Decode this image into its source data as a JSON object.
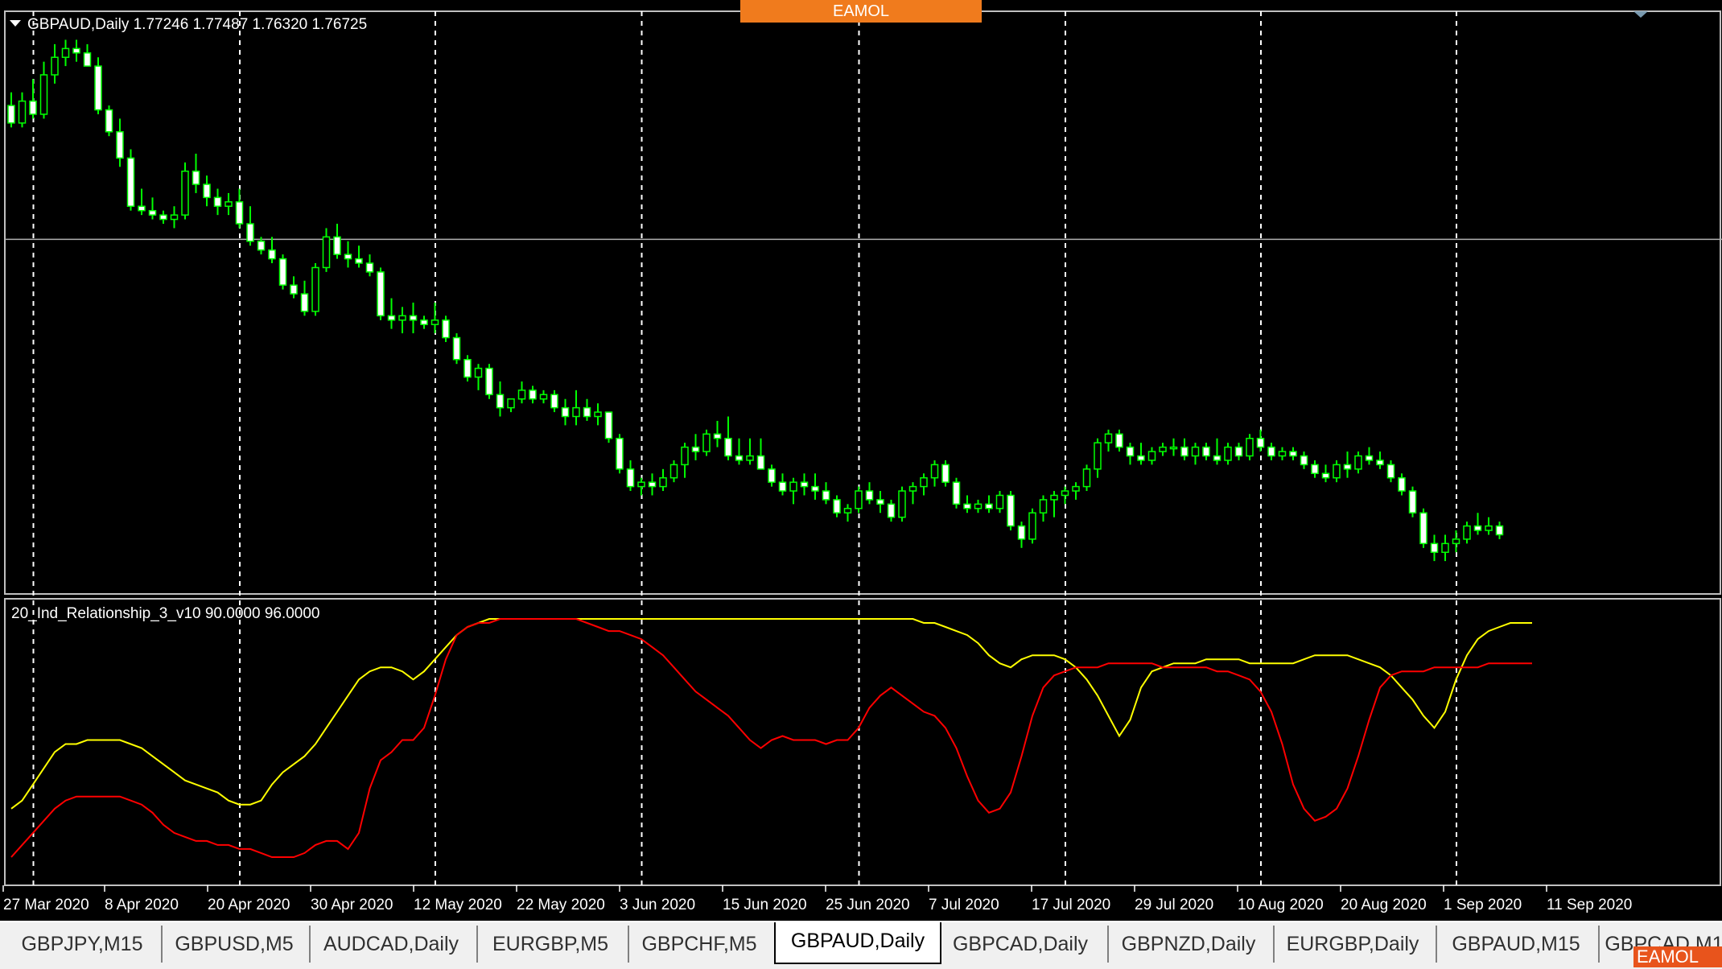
{
  "colors": {
    "candle_up_fill": "#000000",
    "candle_down_fill": "#ffffff",
    "candle_outline": "#00ff00",
    "grid": "#ffffff",
    "indicator_line_1": "#ffff00",
    "indicator_line_2": "#ff0000",
    "background": "#000000"
  },
  "logo": {
    "text": "EAMOL"
  },
  "main_chart": {
    "header": "GBPAUD,Daily  1.77246 1.77487 1.76320 1.76725",
    "price_line": 1.76725
  },
  "indicator": {
    "header": "20_Ind_Relationship_3_v10 90.0000 96.0000",
    "levels": [
      90,
      96
    ]
  },
  "x_axis_labels": [
    "27 Mar 2020",
    "8 Apr 2020",
    "20 Apr 2020",
    "30 Apr 2020",
    "12 May 2020",
    "22 May 2020",
    "3 Jun 2020",
    "15 Jun 2020",
    "25 Jun 2020",
    "7 Jul 2020",
    "17 Jul 2020",
    "29 Jul 2020",
    "10 Aug 2020",
    "20 Aug 2020",
    "1 Sep 2020",
    "11 Sep 2020"
  ],
  "tabs": [
    {
      "label": "GBPJPY,M15",
      "active": false
    },
    {
      "label": "GBPUSD,M5",
      "active": false
    },
    {
      "label": "AUDCAD,Daily",
      "active": false
    },
    {
      "label": "EURGBP,M5",
      "active": false
    },
    {
      "label": "GBPCHF,M5",
      "active": false
    },
    {
      "label": "GBPAUD,Daily",
      "active": true
    },
    {
      "label": "GBPCAD,Daily",
      "active": false
    },
    {
      "label": "GBPNZD,Daily",
      "active": false
    },
    {
      "label": "EURGBP,Daily",
      "active": false
    },
    {
      "label": "GBPAUD,M15",
      "active": false
    },
    {
      "label": "GBPCAD,M1",
      "active": false
    }
  ],
  "chart_data": {
    "type": "candlestick",
    "symbol": "GBPAUD",
    "timeframe": "Daily",
    "ohlc": [
      [
        1.92,
        1.935,
        1.895,
        1.9
      ],
      [
        1.9,
        1.935,
        1.895,
        1.925
      ],
      [
        1.925,
        1.95,
        1.905,
        1.91
      ],
      [
        1.91,
        1.97,
        1.905,
        1.955
      ],
      [
        1.955,
        1.99,
        1.945,
        1.975
      ],
      [
        1.975,
        1.995,
        1.965,
        1.985
      ],
      [
        1.985,
        1.995,
        1.97,
        1.98
      ],
      [
        1.98,
        1.99,
        1.97,
        1.965
      ],
      [
        1.965,
        1.975,
        1.91,
        1.915
      ],
      [
        1.915,
        1.92,
        1.885,
        1.89
      ],
      [
        1.89,
        1.905,
        1.85,
        1.86
      ],
      [
        1.86,
        1.87,
        1.8,
        1.805
      ],
      [
        1.805,
        1.825,
        1.795,
        1.8
      ],
      [
        1.8,
        1.815,
        1.79,
        1.795
      ],
      [
        1.795,
        1.8,
        1.785,
        1.79
      ],
      [
        1.79,
        1.805,
        1.78,
        1.795
      ],
      [
        1.795,
        1.855,
        1.79,
        1.845
      ],
      [
        1.845,
        1.865,
        1.82,
        1.83
      ],
      [
        1.83,
        1.84,
        1.805,
        1.815
      ],
      [
        1.815,
        1.825,
        1.795,
        1.805
      ],
      [
        1.805,
        1.82,
        1.795,
        1.81
      ],
      [
        1.81,
        1.825,
        1.78,
        1.785
      ],
      [
        1.785,
        1.805,
        1.76,
        1.765
      ],
      [
        1.765,
        1.77,
        1.75,
        1.755
      ],
      [
        1.755,
        1.77,
        1.74,
        1.745
      ],
      [
        1.745,
        1.75,
        1.71,
        1.715
      ],
      [
        1.715,
        1.725,
        1.7,
        1.705
      ],
      [
        1.705,
        1.72,
        1.68,
        1.685
      ],
      [
        1.685,
        1.74,
        1.68,
        1.735
      ],
      [
        1.735,
        1.78,
        1.73,
        1.77
      ],
      [
        1.77,
        1.785,
        1.745,
        1.75
      ],
      [
        1.75,
        1.765,
        1.735,
        1.745
      ],
      [
        1.745,
        1.76,
        1.735,
        1.74
      ],
      [
        1.74,
        1.75,
        1.725,
        1.73
      ],
      [
        1.73,
        1.735,
        1.675,
        1.68
      ],
      [
        1.68,
        1.7,
        1.665,
        1.675
      ],
      [
        1.675,
        1.69,
        1.66,
        1.68
      ],
      [
        1.68,
        1.695,
        1.66,
        1.675
      ],
      [
        1.675,
        1.68,
        1.665,
        1.67
      ],
      [
        1.67,
        1.695,
        1.66,
        1.675
      ],
      [
        1.675,
        1.68,
        1.65,
        1.655
      ],
      [
        1.655,
        1.66,
        1.625,
        1.63
      ],
      [
        1.63,
        1.635,
        1.605,
        1.61
      ],
      [
        1.61,
        1.625,
        1.595,
        1.62
      ],
      [
        1.62,
        1.625,
        1.585,
        1.59
      ],
      [
        1.59,
        1.605,
        1.565,
        1.575
      ],
      [
        1.575,
        1.585,
        1.57,
        1.585
      ],
      [
        1.585,
        1.605,
        1.58,
        1.595
      ],
      [
        1.595,
        1.6,
        1.58,
        1.585
      ],
      [
        1.585,
        1.595,
        1.58,
        1.59
      ],
      [
        1.59,
        1.595,
        1.57,
        1.575
      ],
      [
        1.575,
        1.585,
        1.555,
        1.565
      ],
      [
        1.565,
        1.595,
        1.555,
        1.575
      ],
      [
        1.575,
        1.585,
        1.56,
        1.565
      ],
      [
        1.565,
        1.58,
        1.555,
        1.57
      ],
      [
        1.57,
        1.57,
        1.535,
        1.54
      ],
      [
        1.54,
        1.545,
        1.5,
        1.505
      ],
      [
        1.505,
        1.515,
        1.48,
        1.485
      ],
      [
        1.485,
        1.495,
        1.475,
        1.49
      ],
      [
        1.49,
        1.5,
        1.475,
        1.485
      ],
      [
        1.485,
        1.505,
        1.48,
        1.495
      ],
      [
        1.495,
        1.515,
        1.49,
        1.51
      ],
      [
        1.51,
        1.535,
        1.495,
        1.53
      ],
      [
        1.53,
        1.545,
        1.515,
        1.525
      ],
      [
        1.525,
        1.55,
        1.52,
        1.545
      ],
      [
        1.545,
        1.56,
        1.53,
        1.54
      ],
      [
        1.54,
        1.565,
        1.515,
        1.52
      ],
      [
        1.52,
        1.54,
        1.51,
        1.515
      ],
      [
        1.515,
        1.54,
        1.51,
        1.52
      ],
      [
        1.52,
        1.54,
        1.505,
        1.505
      ],
      [
        1.505,
        1.51,
        1.485,
        1.49
      ],
      [
        1.49,
        1.5,
        1.475,
        1.48
      ],
      [
        1.48,
        1.495,
        1.465,
        1.49
      ],
      [
        1.49,
        1.5,
        1.475,
        1.485
      ],
      [
        1.485,
        1.5,
        1.47,
        1.48
      ],
      [
        1.48,
        1.49,
        1.465,
        1.47
      ],
      [
        1.47,
        1.475,
        1.45,
        1.455
      ],
      [
        1.455,
        1.465,
        1.445,
        1.46
      ],
      [
        1.46,
        1.485,
        1.455,
        1.48
      ],
      [
        1.48,
        1.49,
        1.465,
        1.47
      ],
      [
        1.47,
        1.48,
        1.455,
        1.465
      ],
      [
        1.465,
        1.47,
        1.445,
        1.45
      ],
      [
        1.45,
        1.485,
        1.445,
        1.48
      ],
      [
        1.48,
        1.49,
        1.465,
        1.485
      ],
      [
        1.485,
        1.5,
        1.475,
        1.495
      ],
      [
        1.495,
        1.515,
        1.485,
        1.51
      ],
      [
        1.51,
        1.515,
        1.485,
        1.49
      ],
      [
        1.49,
        1.495,
        1.46,
        1.465
      ],
      [
        1.465,
        1.475,
        1.455,
        1.46
      ],
      [
        1.46,
        1.47,
        1.455,
        1.465
      ],
      [
        1.465,
        1.475,
        1.455,
        1.46
      ],
      [
        1.46,
        1.48,
        1.455,
        1.475
      ],
      [
        1.475,
        1.48,
        1.435,
        1.44
      ],
      [
        1.44,
        1.445,
        1.415,
        1.425
      ],
      [
        1.425,
        1.46,
        1.42,
        1.455
      ],
      [
        1.455,
        1.475,
        1.445,
        1.47
      ],
      [
        1.47,
        1.48,
        1.45,
        1.475
      ],
      [
        1.475,
        1.485,
        1.465,
        1.48
      ],
      [
        1.48,
        1.49,
        1.47,
        1.485
      ],
      [
        1.485,
        1.51,
        1.48,
        1.505
      ],
      [
        1.505,
        1.54,
        1.495,
        1.535
      ],
      [
        1.535,
        1.55,
        1.525,
        1.545
      ],
      [
        1.545,
        1.55,
        1.525,
        1.53
      ],
      [
        1.53,
        1.535,
        1.51,
        1.52
      ],
      [
        1.52,
        1.535,
        1.51,
        1.515
      ],
      [
        1.515,
        1.53,
        1.51,
        1.525
      ],
      [
        1.525,
        1.535,
        1.52,
        1.53
      ],
      [
        1.53,
        1.54,
        1.52,
        1.53
      ],
      [
        1.53,
        1.54,
        1.515,
        1.52
      ],
      [
        1.52,
        1.535,
        1.51,
        1.53
      ],
      [
        1.53,
        1.535,
        1.515,
        1.52
      ],
      [
        1.52,
        1.54,
        1.51,
        1.515
      ],
      [
        1.515,
        1.535,
        1.51,
        1.53
      ],
      [
        1.53,
        1.535,
        1.515,
        1.52
      ],
      [
        1.52,
        1.545,
        1.515,
        1.54
      ],
      [
        1.54,
        1.55,
        1.525,
        1.53
      ],
      [
        1.53,
        1.535,
        1.515,
        1.52
      ],
      [
        1.52,
        1.53,
        1.515,
        1.525
      ],
      [
        1.525,
        1.53,
        1.515,
        1.52
      ],
      [
        1.52,
        1.525,
        1.505,
        1.51
      ],
      [
        1.51,
        1.515,
        1.495,
        1.5
      ],
      [
        1.5,
        1.51,
        1.49,
        1.495
      ],
      [
        1.495,
        1.515,
        1.49,
        1.51
      ],
      [
        1.51,
        1.525,
        1.495,
        1.505
      ],
      [
        1.505,
        1.525,
        1.5,
        1.52
      ],
      [
        1.52,
        1.53,
        1.51,
        1.515
      ],
      [
        1.515,
        1.525,
        1.505,
        1.51
      ],
      [
        1.51,
        1.515,
        1.49,
        1.495
      ],
      [
        1.495,
        1.5,
        1.475,
        1.48
      ],
      [
        1.48,
        1.485,
        1.45,
        1.455
      ],
      [
        1.455,
        1.46,
        1.415,
        1.42
      ],
      [
        1.42,
        1.43,
        1.4,
        1.41
      ],
      [
        1.41,
        1.43,
        1.4,
        1.42
      ],
      [
        1.42,
        1.435,
        1.41,
        1.425
      ],
      [
        1.425,
        1.445,
        1.42,
        1.44
      ],
      [
        1.44,
        1.455,
        1.43,
        1.435
      ],
      [
        1.435,
        1.45,
        1.43,
        1.44
      ],
      [
        1.44,
        1.445,
        1.425,
        1.43
      ]
    ],
    "indicator_series": [
      {
        "color": "#ffff00",
        "values": [
          50,
          52,
          56,
          60,
          64,
          66,
          66,
          67,
          67,
          67,
          67,
          66,
          65,
          63,
          61,
          59,
          57,
          56,
          55,
          54,
          52,
          51,
          51,
          52,
          56,
          59,
          61,
          63,
          66,
          70,
          74,
          78,
          82,
          84,
          85,
          85,
          84,
          82,
          84,
          87,
          90,
          93,
          95,
          96,
          97,
          97,
          97,
          97,
          97,
          97,
          97,
          97,
          97,
          97,
          97,
          97,
          97,
          97,
          97,
          97,
          97,
          97,
          97,
          97,
          97,
          97,
          97,
          97,
          97,
          97,
          97,
          97,
          97,
          97,
          97,
          97,
          97,
          97,
          97,
          97,
          97,
          97,
          97,
          97,
          96,
          96,
          95,
          94,
          93,
          91,
          88,
          86,
          85,
          87,
          88,
          88,
          88,
          87,
          85,
          82,
          78,
          73,
          68,
          72,
          80,
          84,
          85,
          86,
          86,
          86,
          87,
          87,
          87,
          87,
          86,
          86,
          86,
          86,
          86,
          87,
          88,
          88,
          88,
          88,
          87,
          86,
          85,
          83,
          80,
          77,
          73,
          70,
          74,
          82,
          88,
          92,
          94,
          95,
          96,
          96,
          96
        ]
      },
      {
        "color": "#ff0000",
        "values": [
          38,
          41,
          44,
          47,
          50,
          52,
          53,
          53,
          53,
          53,
          53,
          52,
          51,
          49,
          46,
          44,
          43,
          42,
          42,
          41,
          41,
          40,
          40,
          39,
          38,
          38,
          38,
          39,
          41,
          42,
          42,
          40,
          44,
          55,
          62,
          64,
          67,
          67,
          70,
          78,
          87,
          93,
          95,
          96,
          96,
          97,
          97,
          97,
          97,
          97,
          97,
          97,
          97,
          96,
          95,
          94,
          94,
          93,
          92,
          90,
          88,
          85,
          82,
          79,
          77,
          75,
          73,
          70,
          67,
          65,
          67,
          68,
          67,
          67,
          67,
          66,
          67,
          67,
          70,
          75,
          78,
          80,
          78,
          76,
          74,
          73,
          70,
          65,
          58,
          52,
          49,
          50,
          54,
          63,
          73,
          80,
          83,
          84,
          85,
          85,
          85,
          86,
          86,
          86,
          86,
          86,
          85,
          85,
          85,
          85,
          85,
          84,
          84,
          83,
          82,
          79,
          74,
          66,
          56,
          50,
          47,
          48,
          50,
          55,
          63,
          72,
          80,
          83,
          84,
          84,
          84,
          85,
          85,
          85,
          85,
          85,
          86,
          86,
          86,
          86,
          86
        ]
      }
    ]
  }
}
